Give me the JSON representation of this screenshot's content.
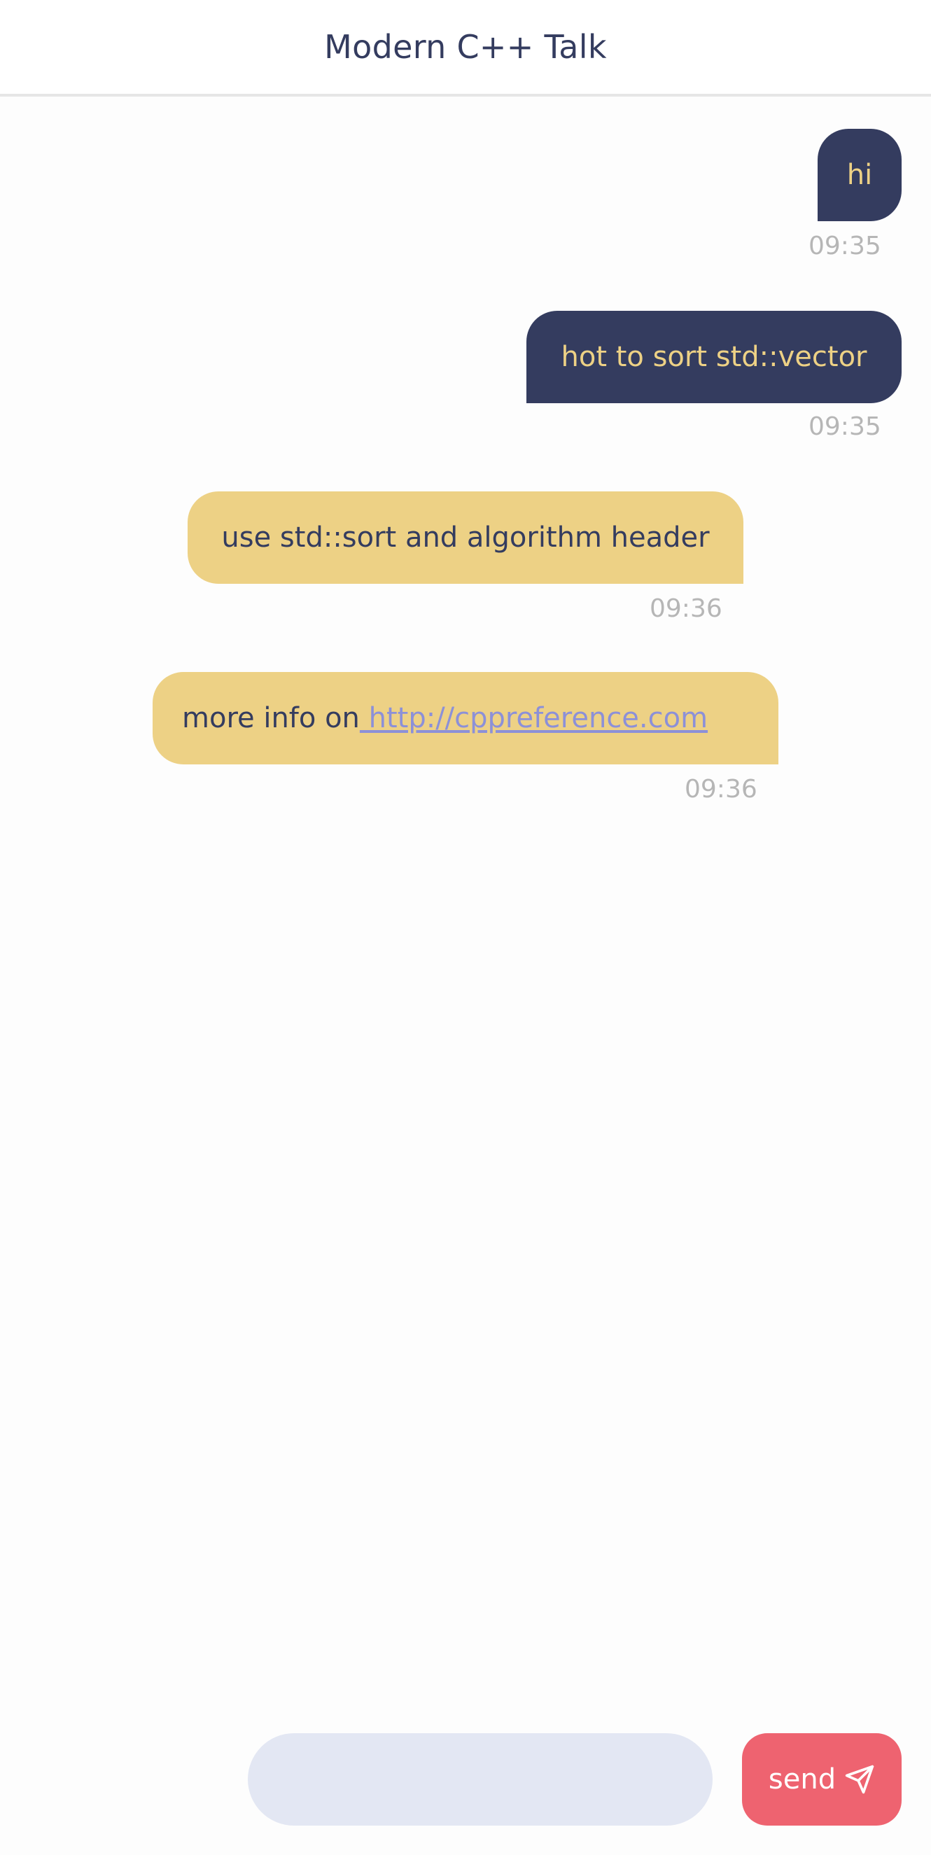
{
  "header": {
    "title": "Modern C++ Talk"
  },
  "messages": [
    {
      "text": "hi",
      "time": "09:35",
      "direction": "outgoing"
    },
    {
      "text": "hot to sort std::vector",
      "time": "09:35",
      "direction": "outgoing"
    },
    {
      "text": "use std::sort and algorithm header",
      "time": "09:36",
      "direction": "incoming"
    },
    {
      "text": "more info on",
      "link": " http://cppreference.com ",
      "time": "09:36",
      "direction": "incoming"
    }
  ],
  "composer": {
    "input_value": "",
    "send_label": "send",
    "send_icon": "paper-plane-icon"
  },
  "colors": {
    "primary": "#343c5f",
    "accent": "#edd185",
    "send_button": "#ee6370",
    "input_background": "#e3e7f3",
    "timestamp": "#b6b6b6",
    "link": "#8c90d8"
  }
}
